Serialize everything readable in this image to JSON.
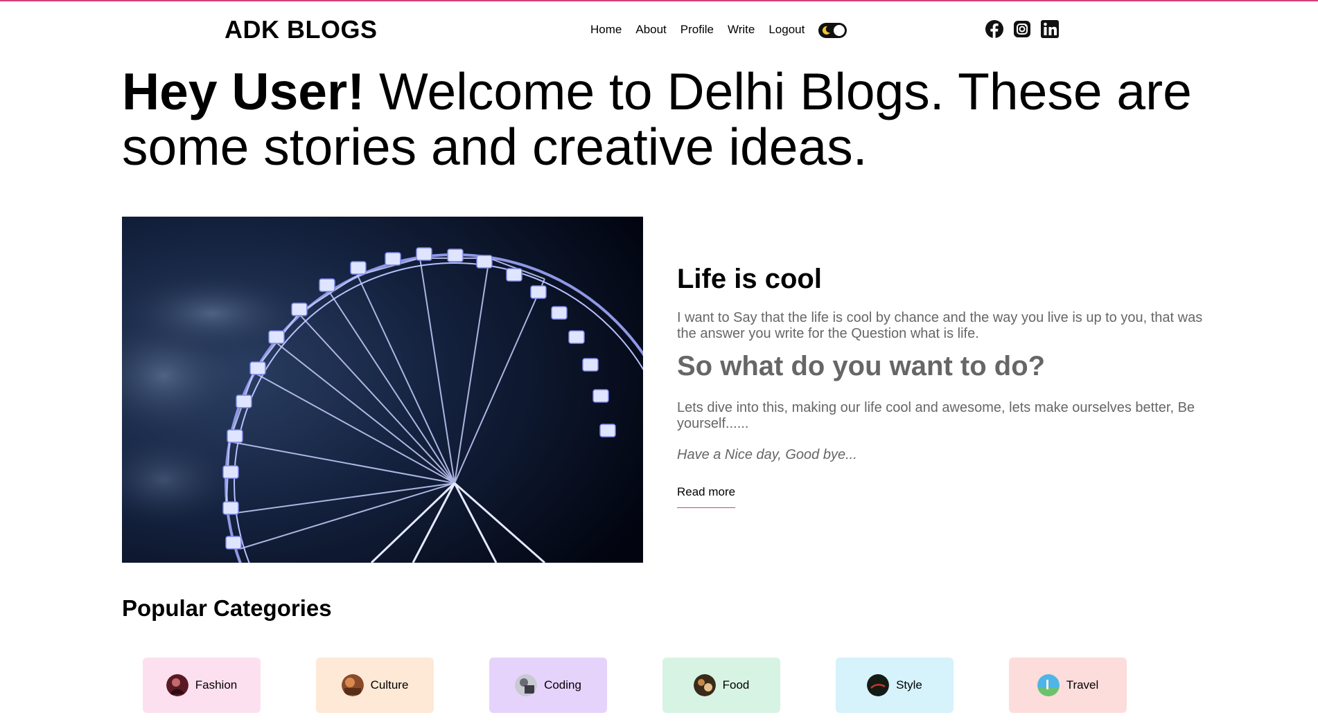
{
  "brand": {
    "logo": "ADK BLOGS",
    "accent_color": "#d1407a"
  },
  "nav": {
    "items": [
      {
        "label": "Home"
      },
      {
        "label": "About"
      },
      {
        "label": "Profile"
      },
      {
        "label": "Write"
      },
      {
        "label": "Logout"
      }
    ],
    "theme_toggle": {
      "icon": "moon-icon",
      "state": "dark-toggle"
    }
  },
  "social": [
    {
      "icon": "facebook-icon"
    },
    {
      "icon": "instagram-icon"
    },
    {
      "icon": "linkedin-icon"
    }
  ],
  "hero": {
    "greeting": "Hey User!",
    "message": "Welcome to Delhi Blogs. These are some stories and creative ideas."
  },
  "featured_post": {
    "image": "ferris-wheel-night",
    "title": "Life is cool",
    "paragraph_1": "I want to Say that the life is cool by chance and the way you live is up to you, that was the answer you write for the Question what is life.",
    "subheading": "So what do you want to do?",
    "paragraph_2": "Lets dive into this, making our life cool and awesome, lets make ourselves better, Be yourself......",
    "sign_off": "Have a Nice day, Good bye...",
    "read_more": "Read more"
  },
  "categories": {
    "heading": "Popular Categories",
    "items": [
      {
        "label": "Fashion",
        "bg": "#fde0ef"
      },
      {
        "label": "Culture",
        "bg": "#fde9d6"
      },
      {
        "label": "Coding",
        "bg": "#e6d3fb"
      },
      {
        "label": "Food",
        "bg": "#d7f3e4"
      },
      {
        "label": "Style",
        "bg": "#d6f2fb"
      },
      {
        "label": "Travel",
        "bg": "#fddcdc"
      }
    ]
  }
}
